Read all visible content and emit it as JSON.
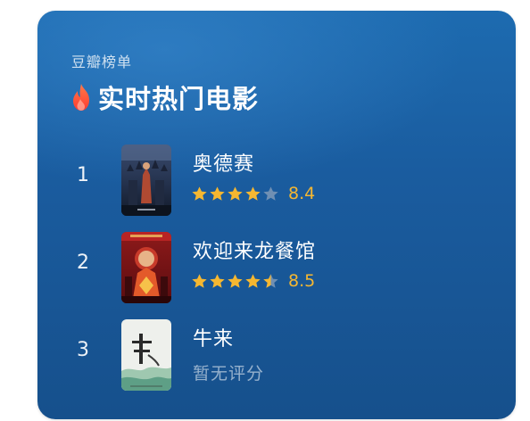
{
  "card": {
    "source_label": "豆瓣榜单",
    "title": "实时热门电影",
    "title_icon": "flame-icon"
  },
  "colors": {
    "card_background": "#1a5c9f",
    "star_filled": "#f5b731",
    "star_empty": "#6f8fb3",
    "score_text": "#f5b731",
    "flame": "#ff5a3c"
  },
  "movies": [
    {
      "rank": "1",
      "title": "奥德赛",
      "stars": 4,
      "score": "8.4",
      "rated": true
    },
    {
      "rank": "2",
      "title": "欢迎来龙餐馆",
      "stars": 4.5,
      "score": "8.5",
      "rated": true
    },
    {
      "rank": "3",
      "title": "牛来",
      "no_rating_text": "暂无评分",
      "rated": false
    }
  ]
}
